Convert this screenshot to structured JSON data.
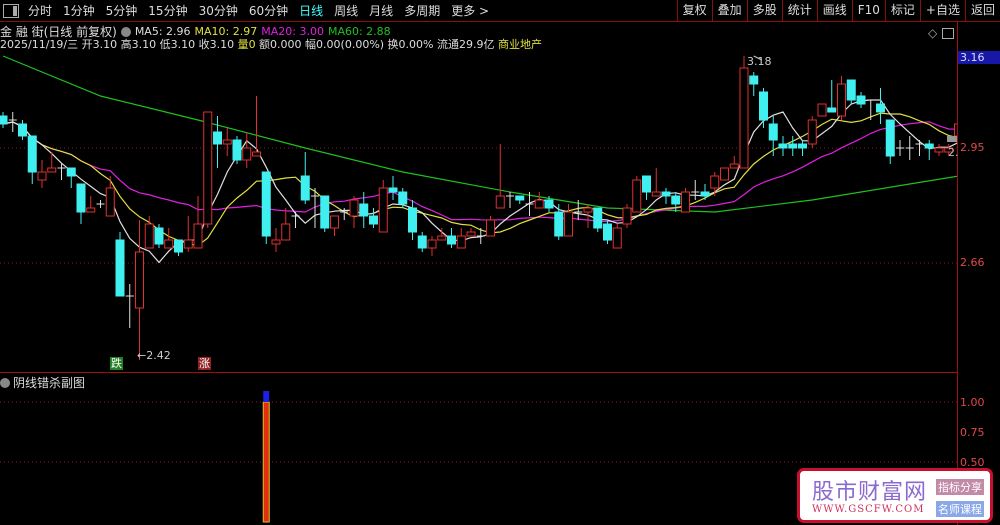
{
  "toolbar": {
    "periods": [
      "分时",
      "1分钟",
      "5分钟",
      "15分钟",
      "30分钟",
      "60分钟",
      "日线",
      "周线",
      "月线",
      "多周期",
      "更多 >"
    ],
    "active_period": "日线",
    "right_buttons": [
      "复权",
      "叠加",
      "多股",
      "统计",
      "画线",
      "F10",
      "标记",
      "+自选",
      "返回"
    ]
  },
  "header": {
    "stock": "金 融 街(日线 前复权)",
    "ma5": "MA5: 2.96",
    "ma10": "MA10: 2.97",
    "ma20": "MA20: 3.00",
    "ma60": "MA60: 2.88",
    "info": "2025/11/19/三 开3.10 高3.10 低3.10 收3.10 ",
    "vol_label": "量",
    "vol_value": "0",
    "rest": " 额0.000 幅0.00(0.00%) 换0.00% 流通29.9亿 ",
    "sector": "商业地产"
  },
  "colors": {
    "up": "#e03030",
    "down": "#40f0f0",
    "ma5": "#e0e0e0",
    "ma10": "#e0e040",
    "ma20": "#e020e0",
    "ma60": "#20c020",
    "sector": "#e0e040"
  },
  "axis": {
    "labels": [
      "3.16",
      "2.95",
      "2.66"
    ],
    "cut_label": "2.",
    "sub_labels": [
      "1.00",
      "0.75",
      "0.50"
    ]
  },
  "annotations": {
    "high": "3.18",
    "low": "←2.42",
    "fall_tag": "跌",
    "rise_tag": "涨"
  },
  "subchart": {
    "title": "阴线错杀副图",
    "signals": [
      {
        "index": 27,
        "value": 1.0
      }
    ]
  },
  "candles": [
    [
      3.03,
      3.04,
      3.0,
      3.01
    ],
    [
      3.02,
      3.04,
      2.99,
      3.02
    ],
    [
      3.01,
      3.02,
      2.97,
      2.98
    ],
    [
      2.98,
      2.98,
      2.86,
      2.89
    ],
    [
      2.87,
      2.92,
      2.85,
      2.89
    ],
    [
      2.89,
      2.94,
      2.89,
      2.9
    ],
    [
      2.9,
      2.91,
      2.87,
      2.9
    ],
    [
      2.9,
      2.9,
      2.85,
      2.88
    ],
    [
      2.86,
      2.86,
      2.76,
      2.79
    ],
    [
      2.79,
      2.83,
      2.79,
      2.8
    ],
    [
      2.81,
      2.82,
      2.8,
      2.81
    ],
    [
      2.78,
      2.88,
      2.78,
      2.85
    ],
    [
      2.72,
      2.74,
      2.58,
      2.58
    ],
    [
      2.58,
      2.61,
      2.5,
      2.58
    ],
    [
      2.55,
      2.77,
      2.42,
      2.69
    ],
    [
      2.7,
      2.78,
      2.7,
      2.76
    ],
    [
      2.75,
      2.76,
      2.7,
      2.71
    ],
    [
      2.7,
      2.75,
      2.7,
      2.72
    ],
    [
      2.72,
      2.72,
      2.68,
      2.69
    ],
    [
      2.7,
      2.78,
      2.69,
      2.72
    ],
    [
      2.7,
      2.83,
      2.7,
      2.76
    ],
    [
      2.76,
      3.04,
      2.75,
      3.04
    ],
    [
      2.99,
      3.03,
      2.9,
      2.96
    ],
    [
      2.96,
      3.0,
      2.93,
      2.97
    ],
    [
      2.97,
      2.98,
      2.91,
      2.92
    ],
    [
      2.92,
      2.99,
      2.9,
      2.95
    ],
    [
      2.93,
      3.08,
      2.93,
      2.94
    ],
    [
      2.89,
      2.89,
      2.71,
      2.73
    ],
    [
      2.71,
      2.75,
      2.69,
      2.72
    ],
    [
      2.72,
      2.8,
      2.72,
      2.76
    ],
    [
      2.78,
      2.79,
      2.75,
      2.78
    ],
    [
      2.88,
      2.94,
      2.81,
      2.82
    ],
    [
      2.83,
      2.85,
      2.75,
      2.83
    ],
    [
      2.83,
      2.83,
      2.74,
      2.75
    ],
    [
      2.75,
      2.78,
      2.73,
      2.78
    ],
    [
      2.79,
      2.8,
      2.77,
      2.79
    ],
    [
      2.78,
      2.83,
      2.75,
      2.82
    ],
    [
      2.81,
      2.84,
      2.75,
      2.78
    ],
    [
      2.78,
      2.8,
      2.75,
      2.76
    ],
    [
      2.74,
      2.87,
      2.74,
      2.85
    ],
    [
      2.85,
      2.88,
      2.82,
      2.84
    ],
    [
      2.84,
      2.85,
      2.8,
      2.81
    ],
    [
      2.8,
      2.82,
      2.72,
      2.74
    ],
    [
      2.73,
      2.74,
      2.69,
      2.7
    ],
    [
      2.7,
      2.73,
      2.68,
      2.72
    ],
    [
      2.72,
      2.75,
      2.72,
      2.73
    ],
    [
      2.73,
      2.75,
      2.7,
      2.71
    ],
    [
      2.7,
      2.75,
      2.7,
      2.73
    ],
    [
      2.73,
      2.75,
      2.73,
      2.74
    ],
    [
      2.73,
      2.75,
      2.71,
      2.73
    ],
    [
      2.73,
      2.78,
      2.73,
      2.77
    ],
    [
      2.8,
      2.96,
      2.8,
      2.83
    ],
    [
      2.83,
      2.84,
      2.8,
      2.83
    ],
    [
      2.83,
      2.83,
      2.81,
      2.82
    ],
    [
      2.81,
      2.84,
      2.78,
      2.81
    ],
    [
      2.8,
      2.84,
      2.8,
      2.82
    ],
    [
      2.82,
      2.83,
      2.79,
      2.8
    ],
    [
      2.79,
      2.81,
      2.72,
      2.73
    ],
    [
      2.73,
      2.81,
      2.73,
      2.79
    ],
    [
      2.79,
      2.82,
      2.77,
      2.79
    ],
    [
      2.79,
      2.81,
      2.75,
      2.8
    ],
    [
      2.8,
      2.8,
      2.74,
      2.75
    ],
    [
      2.76,
      2.77,
      2.71,
      2.72
    ],
    [
      2.7,
      2.76,
      2.7,
      2.75
    ],
    [
      2.76,
      2.81,
      2.75,
      2.8
    ],
    [
      2.79,
      2.88,
      2.79,
      2.87
    ],
    [
      2.88,
      2.88,
      2.82,
      2.84
    ],
    [
      2.83,
      2.9,
      2.83,
      2.84
    ],
    [
      2.84,
      2.85,
      2.81,
      2.83
    ],
    [
      2.83,
      2.84,
      2.79,
      2.81
    ],
    [
      2.79,
      2.85,
      2.79,
      2.84
    ],
    [
      2.84,
      2.87,
      2.82,
      2.84
    ],
    [
      2.84,
      2.86,
      2.82,
      2.83
    ],
    [
      2.85,
      2.89,
      2.83,
      2.88
    ],
    [
      2.87,
      2.9,
      2.87,
      2.9
    ],
    [
      2.9,
      2.93,
      2.9,
      2.91
    ],
    [
      2.9,
      3.18,
      2.9,
      3.15
    ],
    [
      3.13,
      3.14,
      3.08,
      3.11
    ],
    [
      3.09,
      3.1,
      3.0,
      3.02
    ],
    [
      3.01,
      3.03,
      2.93,
      2.97
    ],
    [
      2.96,
      2.98,
      2.93,
      2.95
    ],
    [
      2.96,
      2.98,
      2.93,
      2.95
    ],
    [
      2.96,
      2.97,
      2.93,
      2.95
    ],
    [
      2.96,
      3.03,
      2.95,
      3.02
    ],
    [
      3.03,
      3.06,
      3.03,
      3.06
    ],
    [
      3.05,
      3.12,
      3.04,
      3.04
    ],
    [
      3.03,
      3.13,
      3.02,
      3.11
    ],
    [
      3.12,
      3.12,
      3.06,
      3.07
    ],
    [
      3.08,
      3.09,
      3.05,
      3.06
    ],
    [
      3.07,
      3.07,
      3.02,
      3.07
    ],
    [
      3.06,
      3.1,
      3.01,
      3.04
    ],
    [
      3.02,
      3.02,
      2.91,
      2.93
    ],
    [
      2.95,
      2.97,
      2.93,
      2.95
    ],
    [
      2.95,
      2.98,
      2.92,
      2.95
    ],
    [
      2.96,
      2.97,
      2.93,
      2.96
    ],
    [
      2.96,
      2.97,
      2.92,
      2.95
    ],
    [
      2.94,
      2.96,
      2.93,
      2.95
    ],
    [
      2.94,
      2.96,
      2.93,
      2.95
    ],
    [
      2.98,
      3.04,
      2.94,
      3.01
    ]
  ],
  "ma60_samples": [
    [
      0,
      3.18
    ],
    [
      10,
      3.08
    ],
    [
      20,
      3.02
    ],
    [
      31,
      2.95
    ],
    [
      41,
      2.89
    ],
    [
      52,
      2.84
    ],
    [
      62,
      2.8
    ],
    [
      73,
      2.79
    ],
    [
      83,
      2.82
    ],
    [
      93,
      2.86
    ],
    [
      98,
      2.88
    ]
  ],
  "watermark": {
    "name": "股市财富网",
    "url": "WWW.GSCFW.COM",
    "badge1": "指标分享",
    "badge2": "名师课程"
  }
}
